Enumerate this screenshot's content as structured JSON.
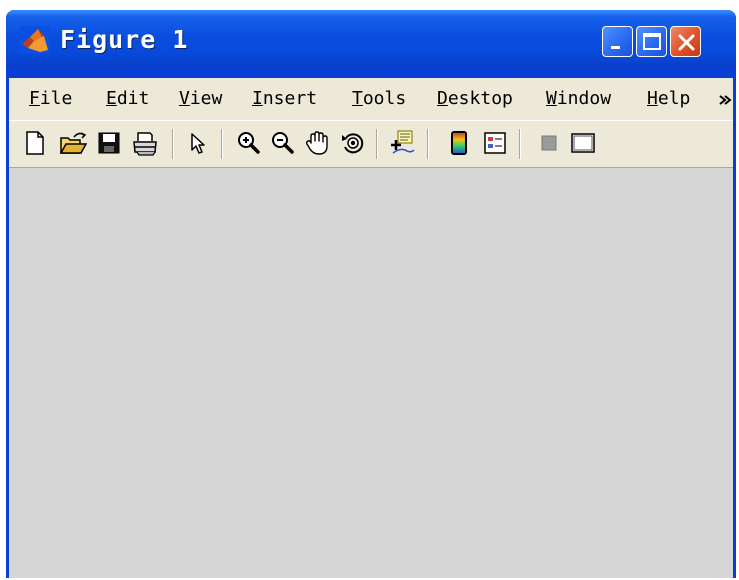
{
  "window": {
    "title": "Figure 1",
    "controls": {
      "minimize": "minimize-icon",
      "maximize": "maximize-icon",
      "close": "close-icon"
    }
  },
  "menubar": {
    "items": [
      {
        "mnemonic": "F",
        "rest": "ile"
      },
      {
        "mnemonic": "E",
        "rest": "dit"
      },
      {
        "mnemonic": "V",
        "rest": "iew"
      },
      {
        "mnemonic": "I",
        "rest": "nsert"
      },
      {
        "mnemonic": "T",
        "rest": "ools"
      },
      {
        "mnemonic": "D",
        "rest": "esktop"
      },
      {
        "mnemonic": "W",
        "rest": "indow"
      },
      {
        "mnemonic": "H",
        "rest": "elp"
      }
    ],
    "overflow_icon": "chevron-double-right-icon"
  },
  "toolbar": {
    "tools": [
      "new-figure-icon",
      "open-file-icon",
      "save-figure-icon",
      "print-figure-icon",
      "edit-plot-arrow-icon",
      "zoom-in-icon",
      "zoom-out-icon",
      "pan-hand-icon",
      "rotate-3d-icon",
      "data-cursor-icon",
      "insert-colorbar-icon",
      "insert-legend-icon",
      "hide-plot-tools-icon",
      "show-plot-tools-icon"
    ]
  },
  "colors": {
    "titlebar": "#0a4fe0",
    "menubar_bg": "#ece9d8",
    "canvas_bg": "#d6d6d6",
    "close_button": "#e0502a"
  }
}
